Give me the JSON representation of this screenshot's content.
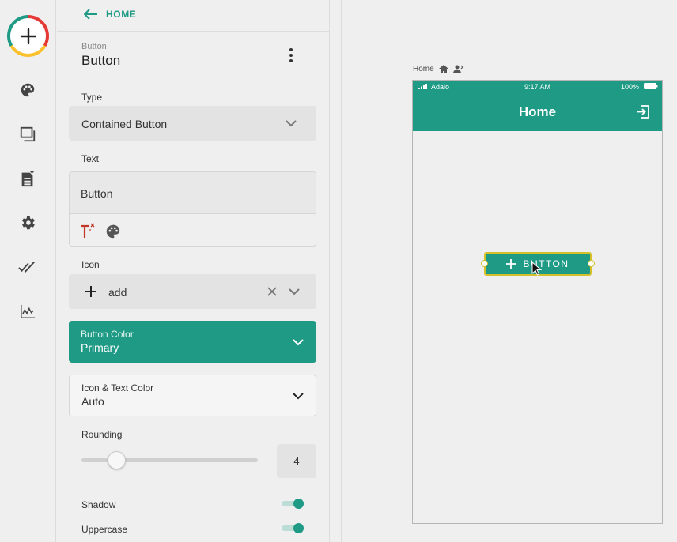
{
  "rail": {
    "items": [
      "palette-icon",
      "screens-icon",
      "database-icon",
      "settings-icon",
      "publish-check-icon",
      "analytics-icon"
    ]
  },
  "panel": {
    "back_label": "HOME",
    "component_type": "Button",
    "component_name": "Button",
    "type_label": "Type",
    "type_value": "Contained Button",
    "text_label": "Text",
    "text_value": "Button",
    "icon_label": "Icon",
    "icon_value": "add",
    "button_color_label": "Button Color",
    "button_color_value": "Primary",
    "icon_text_color_label": "Icon & Text Color",
    "icon_text_color_value": "Auto",
    "rounding_label": "Rounding",
    "rounding_value": "4",
    "rounding_fraction": 0.2,
    "shadow_label": "Shadow",
    "shadow_on": true,
    "uppercase_label": "Uppercase",
    "uppercase_on": true
  },
  "canvas": {
    "screen_label": "Home",
    "status_carrier": "Adalo",
    "status_time": "9:17 AM",
    "status_battery": "100%",
    "appbar_title": "Home",
    "button_label": "BUTTON"
  },
  "colors": {
    "primary": "#1e9a85",
    "selection": "#d4c02a"
  }
}
